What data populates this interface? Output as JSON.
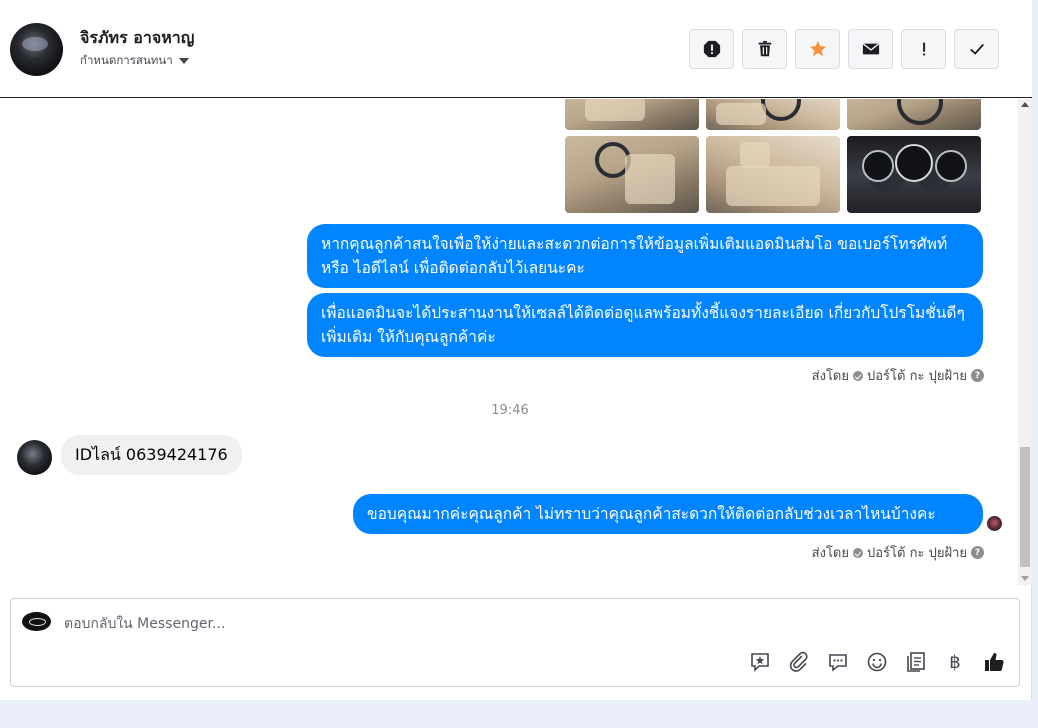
{
  "header": {
    "name": "จิรภัทร อาจหาญ",
    "subtitle": "กำหนดการสนทนา",
    "actions": [
      {
        "name": "report-icon",
        "label": "!"
      },
      {
        "name": "trash-icon",
        "label": ""
      },
      {
        "name": "star-icon",
        "label": ""
      },
      {
        "name": "envelope-icon",
        "label": ""
      },
      {
        "name": "exclamation-icon",
        "label": "!"
      },
      {
        "name": "check-icon",
        "label": ""
      }
    ]
  },
  "messages": {
    "outgoing_1": "หากคุณลูกค้าสนใจเพื่อให้ง่ายและสะดวกต่อการให้ข้อมูลเพิ่มเติมแอดมินส่มโอ ขอเบอร์โทรศัพท์ หรือ ไอดีไลน์ เพื่อติดต่อกลับไว้เลยนะคะ",
    "outgoing_2": "เพื่อแอดมินจะได้ประสานงานให้เซลล์ได้ติดต่อดูแลพร้อมทั้งชี้แจงรายละเอียด เกี่ยวกับโปรโมชั่นดีๆเพิ่มเติม ให้กับคุณลูกค้าค่ะ",
    "sent_by_1": {
      "prefix": "ส่งโดย",
      "name": "ปอร์โต้ กะ ปุยฝ้าย",
      "help": "?"
    },
    "time": "19:46",
    "incoming_1": "IDไลน์ 0639424176",
    "outgoing_3": "ขอบคุณมากค่ะคุณลูกค้า ไม่ทราบว่าคุณลูกค้าสะดวกให้ติดต่อกลับช่วงเวลาไหนบ้างคะ",
    "sent_by_2": {
      "prefix": "ส่งโดย",
      "name": "ปอร์โต้ กะ ปุยฝ้าย",
      "help": "?"
    }
  },
  "composer": {
    "placeholder": "ตอบกลับใน Messenger...",
    "tools": [
      "saved-reply-icon",
      "attachment-icon",
      "chat-icon",
      "emoji-icon",
      "notes-icon",
      "baht-icon",
      "like-icon"
    ],
    "baht_symbol": "฿"
  },
  "colors": {
    "accent": "#0084ff",
    "star": "#f7923a",
    "incoming_bubble": "#f0f0f0"
  }
}
